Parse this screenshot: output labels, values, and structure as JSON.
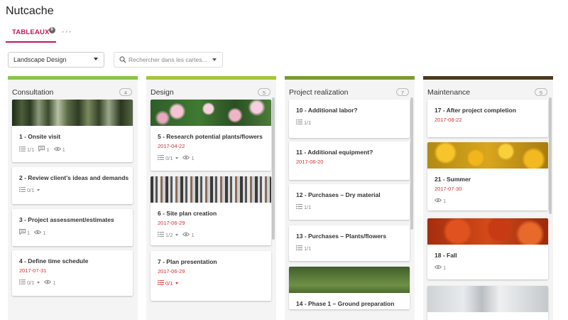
{
  "app": {
    "title": "Nutcache"
  },
  "tabs": [
    {
      "label": "TABLEAUX",
      "badge": "9"
    }
  ],
  "tab_more": "···",
  "board_select": {
    "value": "Landscape Design"
  },
  "search": {
    "placeholder": "Rechercher dans les cartes..."
  },
  "colors": {
    "accent": "#c2185b",
    "date_red": "#d32f2f",
    "consultation_bar": "#8bc34a",
    "design_bar": "#a4c639",
    "realization_bar": "#7b9a32",
    "maintenance_bar": "#4a3b1f"
  },
  "columns": [
    {
      "title": "Consultation",
      "count": "4",
      "cards": [
        {
          "title": "1 -  Onsite visit",
          "image": "forest",
          "meta": [
            {
              "icon": "checklist-icon",
              "text": "1/1"
            },
            {
              "icon": "comment-icon",
              "text": "1"
            },
            {
              "icon": "eye-icon",
              "text": "1"
            }
          ]
        },
        {
          "title": "2 -  Review client's ideas and demands",
          "meta": [
            {
              "icon": "checklist-icon",
              "text": "0/1",
              "dropdown": true
            }
          ]
        },
        {
          "title": "3 -  Project assessment/estimates",
          "meta": [
            {
              "icon": "comment-icon",
              "text": "1"
            },
            {
              "icon": "eye-icon",
              "text": "1"
            }
          ]
        },
        {
          "title": "4 -  Define time schedule",
          "date": "2017-07-31",
          "meta": [
            {
              "icon": "checklist-icon",
              "text": "0/1",
              "dropdown": true
            },
            {
              "icon": "eye-icon",
              "text": "1"
            }
          ]
        }
      ]
    },
    {
      "title": "Design",
      "count": "5",
      "cards": [
        {
          "title": "5 -  Research potential plants/flowers",
          "image": "flowers",
          "date": "2017-04-22",
          "meta": [
            {
              "icon": "checklist-icon",
              "text": "0/1",
              "dropdown": true
            },
            {
              "icon": "eye-icon",
              "text": "1"
            }
          ]
        },
        {
          "title": "6 -  Site plan creation",
          "image": "pencils",
          "date": "2017-06-29",
          "meta": [
            {
              "icon": "checklist-icon",
              "text": "1/2",
              "dropdown": true
            },
            {
              "icon": "eye-icon",
              "text": "1"
            }
          ]
        },
        {
          "title": "7 -  Plan presentation",
          "date": "2017-06-29",
          "meta": [
            {
              "icon": "checklist-icon",
              "text": "0/1",
              "dropdown": true,
              "alert": true
            }
          ]
        }
      ]
    },
    {
      "title": "Project realization",
      "count": "7",
      "cards": [
        {
          "title": "10 -  Additional labor?",
          "meta": [
            {
              "icon": "checklist-icon",
              "text": "1/1"
            }
          ]
        },
        {
          "title": "11 -  Additional equipment?",
          "date": "2017-06-20",
          "meta": []
        },
        {
          "title": "12 -  Purchases – Dry material",
          "meta": [
            {
              "icon": "checklist-icon",
              "text": "1/1"
            }
          ]
        },
        {
          "title": "13 -  Purchases – Plants/flowers",
          "meta": [
            {
              "icon": "checklist-icon",
              "text": "1/1"
            }
          ]
        },
        {
          "title": "14 -  Phase 1 – Ground preparation",
          "image": "field",
          "meta": []
        }
      ]
    },
    {
      "title": "Maintenance",
      "count": "5",
      "cards": [
        {
          "title": "17 -  After project completion",
          "date": "2017-08-22",
          "meta": []
        },
        {
          "title": "21 -  Summer",
          "image": "yellow",
          "date": "2017-07-30",
          "meta": [
            {
              "icon": "eye-icon",
              "text": "1"
            }
          ]
        },
        {
          "title": "18 -  Fall",
          "image": "red",
          "meta": [
            {
              "icon": "eye-icon",
              "text": "1"
            }
          ]
        },
        {
          "title": "",
          "image": "snow",
          "meta": []
        }
      ]
    }
  ]
}
